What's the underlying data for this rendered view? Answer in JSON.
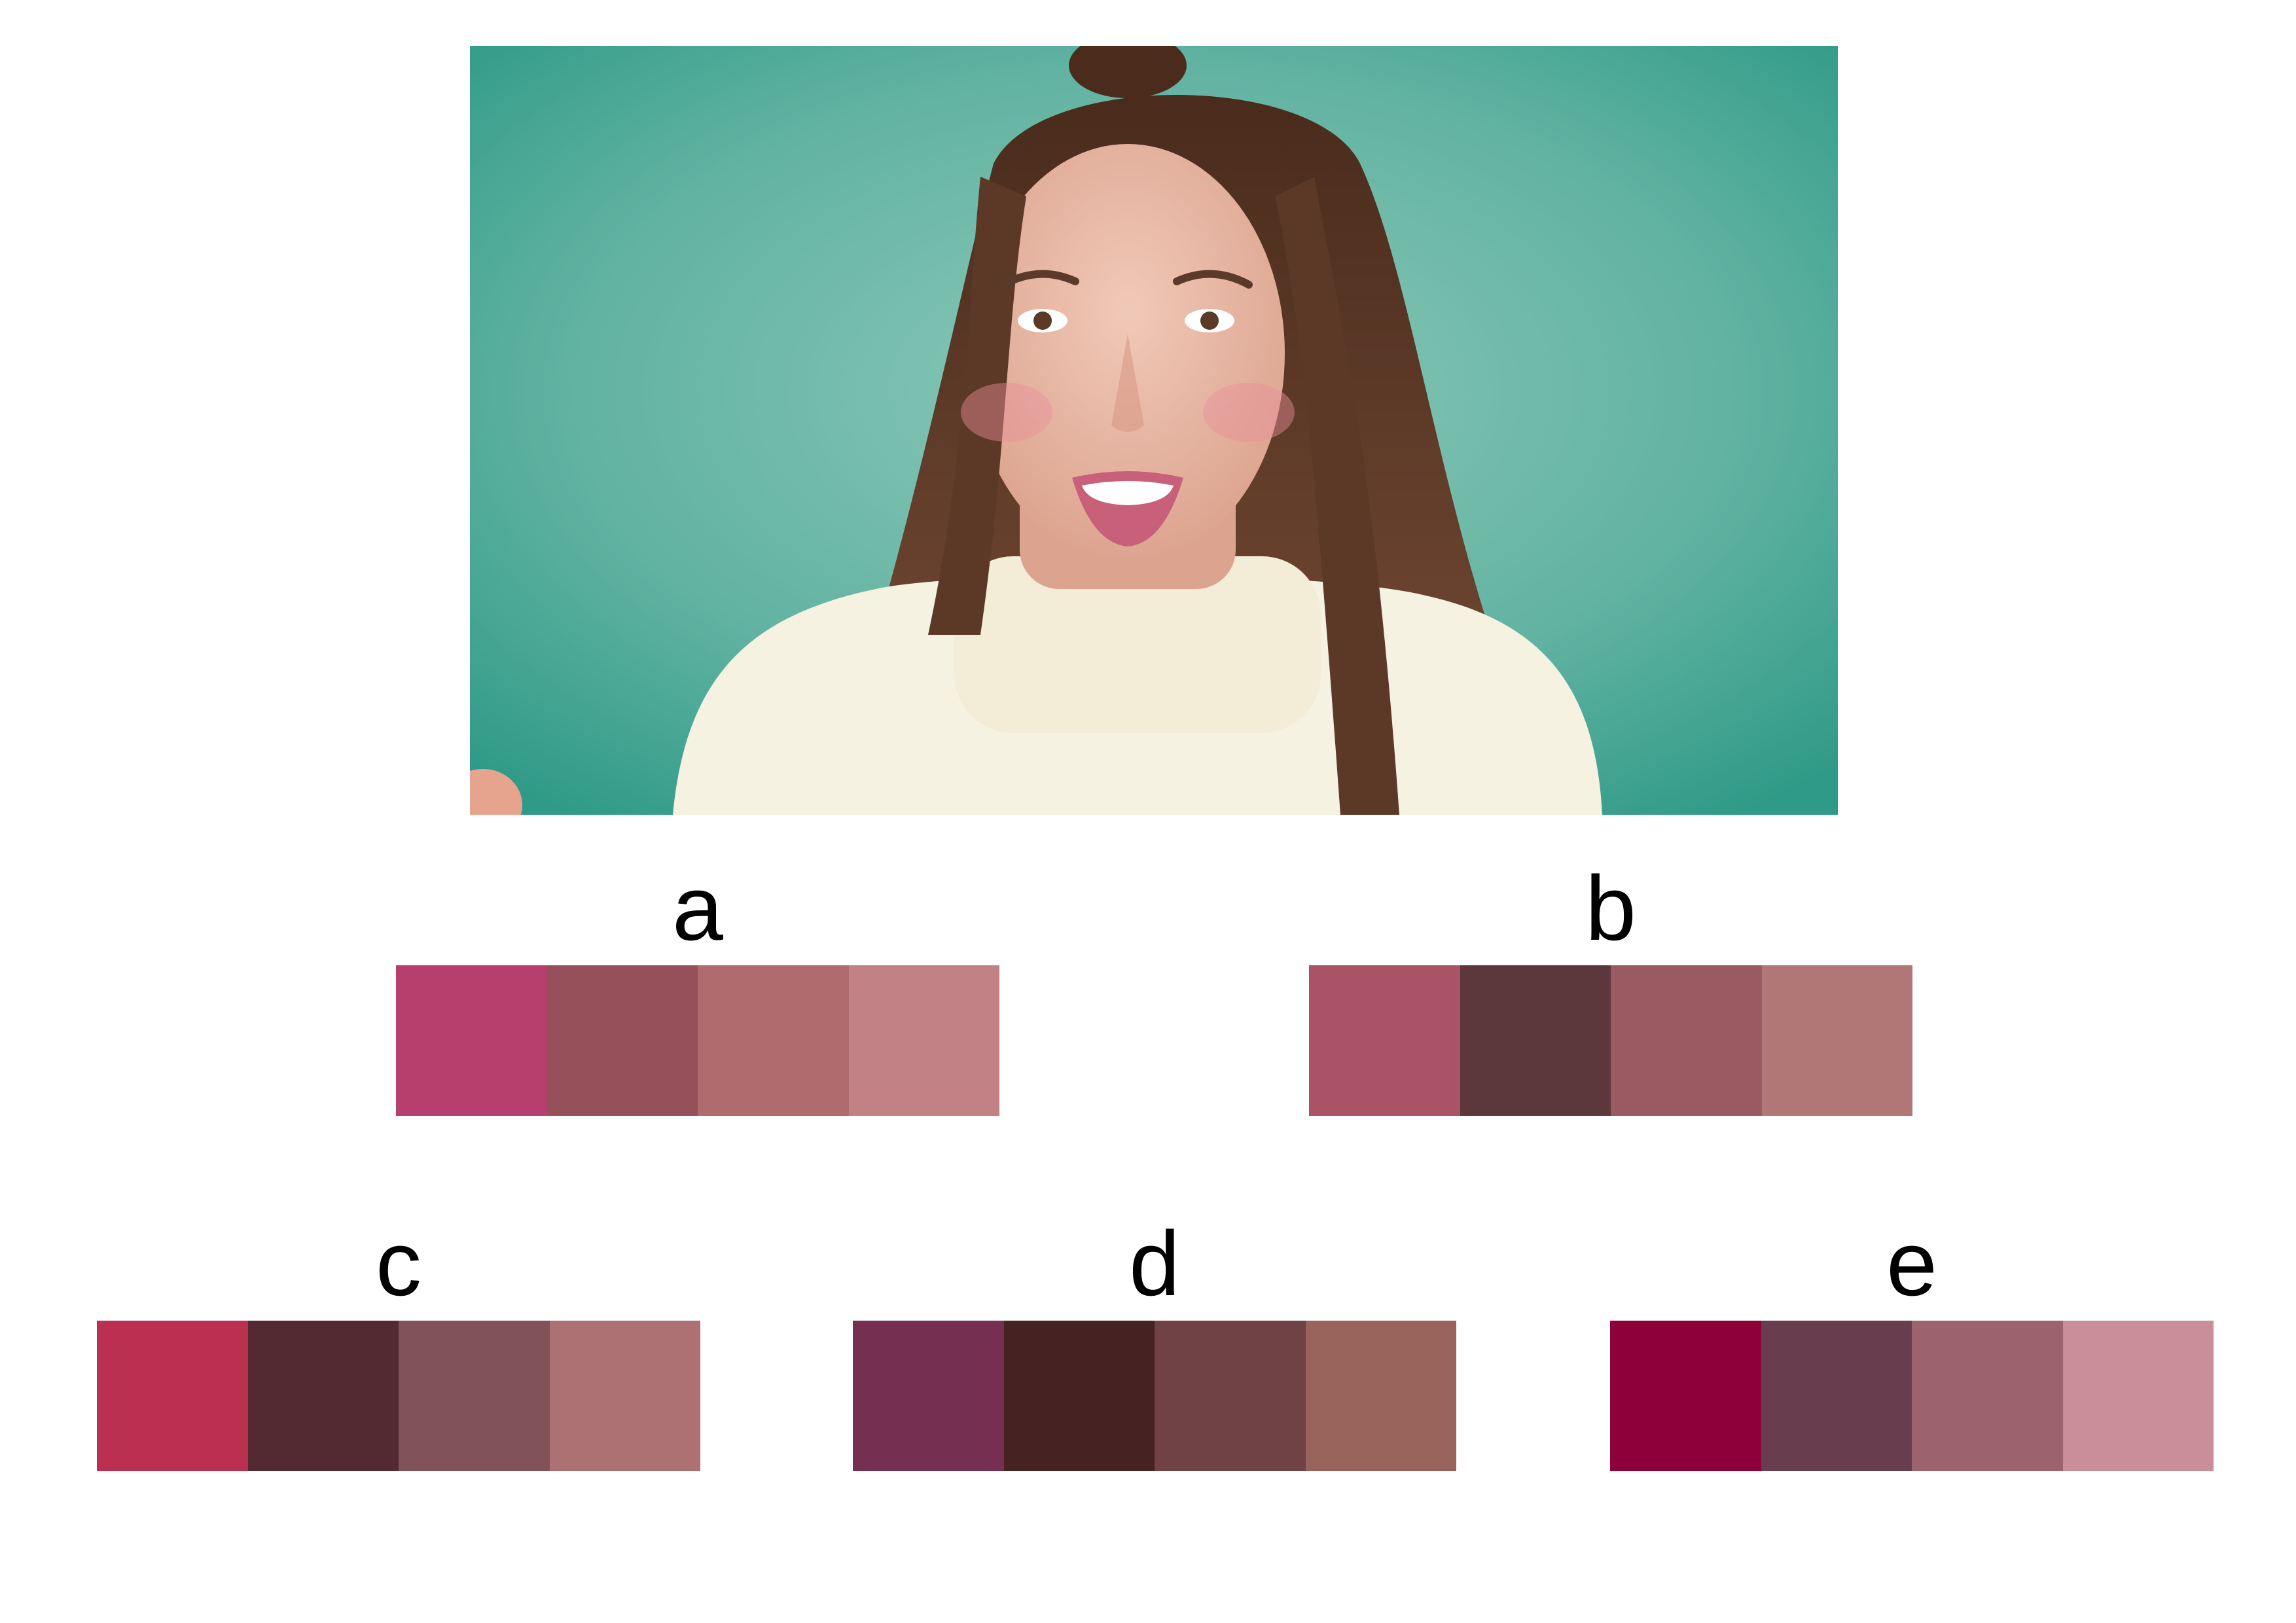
{
  "photo": {
    "description_icon": "portrait-photo-icon",
    "colors": {
      "background": "#62b3a2",
      "hair": "#5c3826",
      "skin": "#e8b9a6",
      "sweater": "#f6f2e2",
      "lips": "#c8607a"
    }
  },
  "palettes": [
    {
      "label": "a",
      "colors": [
        "#b73f6d",
        "#96505a",
        "#af6b6e",
        "#c28185"
      ]
    },
    {
      "label": "b",
      "colors": [
        "#aa5266",
        "#5c373c",
        "#9a5a61",
        "#b17776"
      ]
    },
    {
      "label": "c",
      "colors": [
        "#bb2f50",
        "#532a31",
        "#825259",
        "#ad7173"
      ]
    },
    {
      "label": "d",
      "colors": [
        "#742f51",
        "#472222",
        "#704245",
        "#98635b"
      ]
    },
    {
      "label": "e",
      "colors": [
        "#8e003a",
        "#683e4e",
        "#9d636d",
        "#c98e97"
      ]
    }
  ]
}
